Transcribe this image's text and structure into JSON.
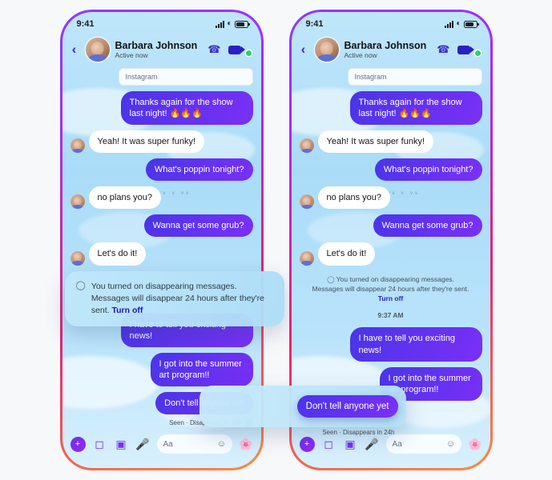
{
  "status": {
    "time": "9:41",
    "signal_icon": "signal-bars-icon",
    "wifi_icon": "wifi-icon",
    "battery_icon": "battery-icon"
  },
  "header": {
    "back_icon": "chevron-left-icon",
    "avatar": "contact-avatar",
    "name": "Barbara Johnson",
    "subtitle": "Active now",
    "call_icon": "phone-icon",
    "video_icon": "video-camera-icon",
    "presence": "online-dot"
  },
  "thread": {
    "source_pill": "Instagram",
    "messages": [
      {
        "from": "me",
        "text": "Thanks again for the show last night! 🔥🔥🔥"
      },
      {
        "from": "them",
        "text": "Yeah! It was super funky!"
      },
      {
        "from": "me",
        "text": "What's poppin tonight?"
      },
      {
        "from": "them",
        "text": "no plans you?"
      },
      {
        "from": "me",
        "text": "Wanna get some grub?"
      },
      {
        "from": "them",
        "text": "Let's do it!"
      }
    ],
    "messages_after": [
      {
        "from": "me",
        "text": "I have to tell you exciting news!"
      },
      {
        "from": "me",
        "text": "I got into the summer art program!!"
      },
      {
        "from": "me",
        "text": "Don't tell anyone yet"
      }
    ],
    "receipt": "Seen · Disappears in 24h",
    "timestamp": "9:37 AM"
  },
  "disappearing_notice": {
    "clock_icon": "clock-icon",
    "text": "You turned on disappearing messages. Messages will disappear 24 hours after they're sent.",
    "action": "Turn off"
  },
  "composer": {
    "plus_icon": "plus-circle-icon",
    "camera_icon": "camera-icon",
    "gallery_icon": "photo-icon",
    "mic_icon": "microphone-icon",
    "placeholder": "Aa",
    "emoji_icon": "smiley-icon",
    "sticker_icon": "sticker-icon"
  },
  "floating_bubble": {
    "text": "Don't tell anyone yet",
    "receipt": "Seen · Disappears in 24h"
  },
  "colors": {
    "accent_purple": "#5b33ef",
    "brand_gradient_start": "#8b3bff",
    "brand_gradient_end": "#ff8a3d",
    "link": "#1f14c0",
    "online": "#25d366"
  }
}
